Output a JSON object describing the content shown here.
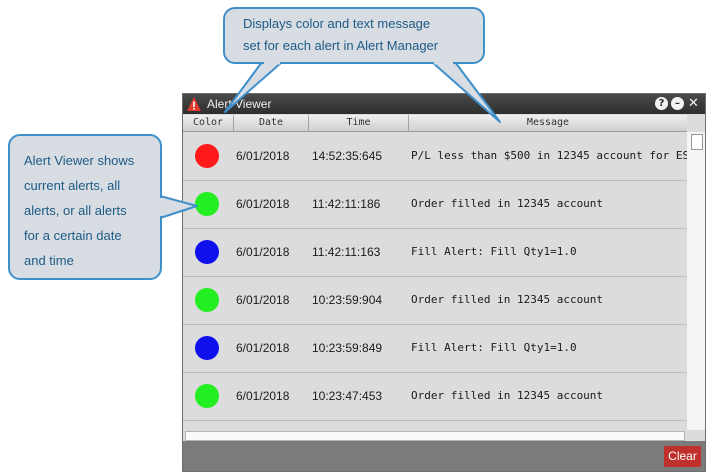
{
  "window": {
    "title": "Alert Viewer",
    "help_glyph": "?",
    "minimize_glyph": "–",
    "close_glyph": "✕"
  },
  "columns": [
    "Color",
    "Date",
    "Time",
    "Message"
  ],
  "alerts": [
    {
      "color": "#ff1a1a",
      "date": "6/01/2018",
      "time": "14:52:35:645",
      "message": "P/L less than $500 in 12345 account for ES"
    },
    {
      "color": "#22ee22",
      "date": "6/01/2018",
      "time": "11:42:11:186",
      "message": "Order filled in 12345 account"
    },
    {
      "color": "#1010ee",
      "date": "6/01/2018",
      "time": "11:42:11:163",
      "message": "Fill Alert: Fill Qty1=1.0"
    },
    {
      "color": "#22ee22",
      "date": "6/01/2018",
      "time": "10:23:59:904",
      "message": "Order filled in 12345 account"
    },
    {
      "color": "#1010ee",
      "date": "6/01/2018",
      "time": "10:23:59:849",
      "message": "Fill Alert: Fill Qty1=1.0"
    },
    {
      "color": "#22ee22",
      "date": "6/01/2018",
      "time": "10:23:47:453",
      "message": "Order filled in 12345 account"
    }
  ],
  "footer": {
    "clear_label": "Clear"
  },
  "callouts": {
    "top": [
      "Displays color and text message",
      "set for each alert in Alert Manager"
    ],
    "left": [
      "Alert Viewer shows",
      "current alerts, all",
      "alerts, or all alerts",
      "for a certain date",
      "and time"
    ]
  }
}
